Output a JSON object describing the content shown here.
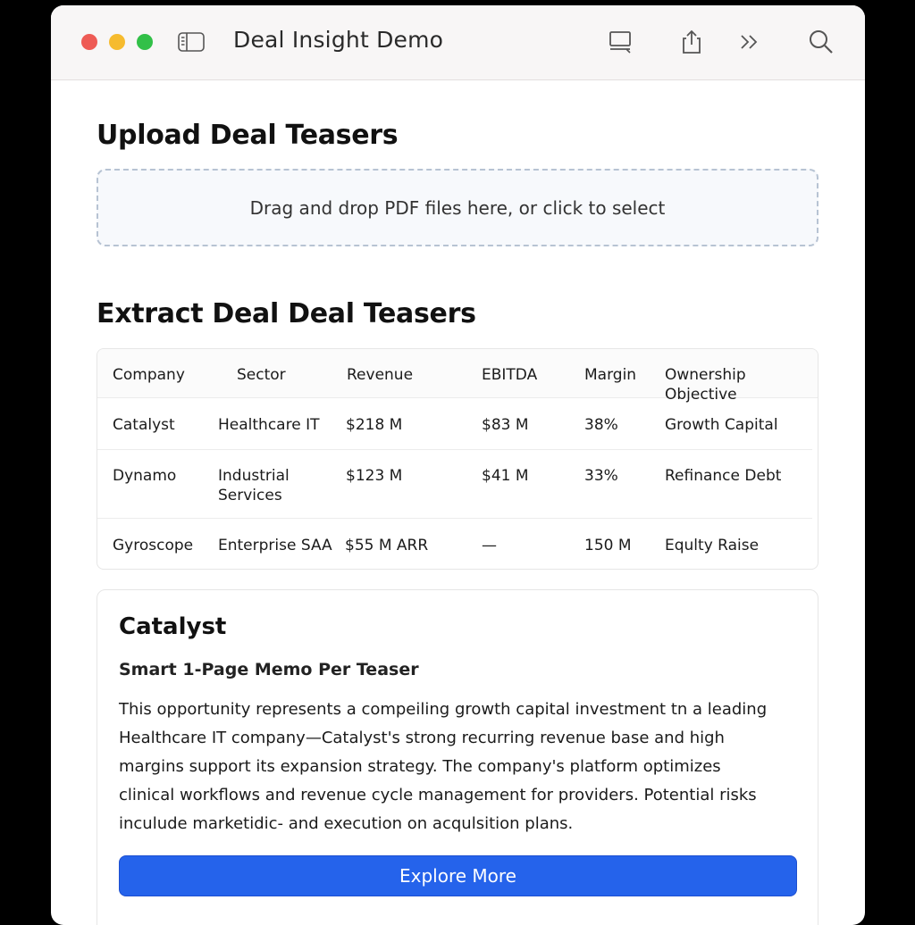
{
  "window": {
    "title": "Deal Insight Demo"
  },
  "toolbar": {
    "icons": [
      "sidebar-icon",
      "display-icon",
      "share-icon",
      "chevrons-right-icon",
      "search-icon"
    ]
  },
  "upload": {
    "heading": "Upload Deal Teasers",
    "dropzone_text": "Drag and drop PDF files here, or click to select"
  },
  "extract": {
    "heading": "Extract Deal Deal Teasers",
    "columns": [
      "Company",
      "Sector",
      "Revenue",
      "EBITDA",
      "Margin",
      "Ownership Objective"
    ],
    "rows": [
      [
        "Catalyst",
        "Healthcare IT",
        "$218 M",
        "$83 M",
        "38%",
        "Growth Capital"
      ],
      [
        "Dynamo",
        "Industrial Services",
        "$123 M",
        "$41 M",
        "33%",
        "Refinance Debt"
      ],
      [
        "Gyroscope",
        "Enterprise SAA",
        "$55 M ARR",
        "—",
        "150 M",
        "Equlty Raise"
      ]
    ]
  },
  "memo": {
    "company": "Catalyst",
    "subtitle": "Smart 1-Page Memo Per Teaser",
    "body": "This opportunity represents a compeiling growth capital investment tn a leading Healthcare IT company—Catalyst's strong recurring revenue base and high margins support its expansion strategy. The company's platform optimizes clinical workflows and revenue cycle management for providers. Potential risks inculude marketidic- and execution on acqulsition plans.",
    "button_label": "Explore More"
  },
  "colors": {
    "accent": "#2563eb",
    "close": "#ee5b55",
    "minimize": "#f6bb2e",
    "zoom": "#32c048"
  }
}
